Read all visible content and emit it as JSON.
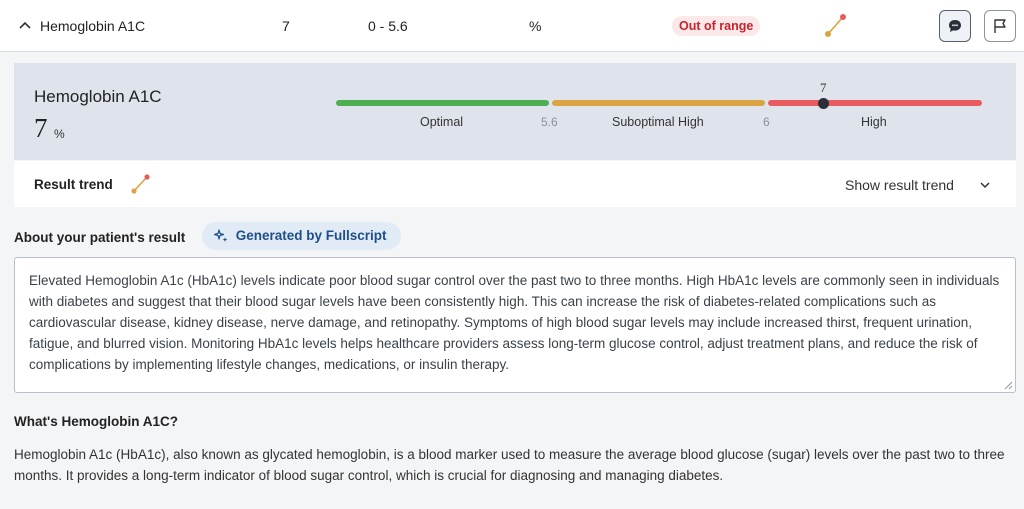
{
  "test_row": {
    "name": "Hemoglobin A1C",
    "value": "7",
    "range": "0 - 5.6",
    "unit": "%",
    "status": "Out of range"
  },
  "detail": {
    "title": "Hemoglobin A1C",
    "value": "7",
    "unit": "%",
    "scale": {
      "marker_value": 7,
      "marker_label": "7",
      "segments": [
        {
          "label": "Optimal",
          "from": 0,
          "to": 5.6,
          "color": "#4caf50"
        },
        {
          "label": "Suboptimal High",
          "from": 5.6,
          "to": 6,
          "color": "#d9a441"
        },
        {
          "label": "High",
          "from": 6,
          "to": null,
          "color": "#e85b5e"
        }
      ],
      "ticks": [
        "5.6",
        "6"
      ]
    }
  },
  "trend": {
    "label": "Result trend",
    "toggle_label": "Show result trend"
  },
  "about": {
    "label": "About your patient's result",
    "generated_label": "Generated by Fullscript",
    "summary": "Elevated Hemoglobin A1c (HbA1c) levels indicate poor blood sugar control over the past two to three months. High HbA1c levels are commonly seen in individuals with diabetes and suggest that their blood sugar levels have been consistently high. This can increase the risk of diabetes-related complications such as cardiovascular disease, kidney disease, nerve damage, and retinopathy. Symptoms of high blood sugar levels may include increased thirst, frequent urination, fatigue, and blurred vision. Monitoring HbA1c levels helps healthcare providers assess long-term glucose control, adjust treatment plans, and reduce the risk of complications by implementing lifestyle changes, medications, or insulin therapy."
  },
  "what": {
    "title": "What's Hemoglobin A1C?",
    "text": "Hemoglobin A1c (HbA1c), also known as glycated hemoglobin, is a blood marker used to measure the average blood glucose (sugar) levels over the past two to three months. It provides a long-term indicator of blood sugar control, which is crucial for diagnosing and managing diabetes."
  },
  "colors": {
    "out_of_range_text": "#c8232c",
    "out_of_range_bg": "#fbe9ea",
    "pill_text": "#1f4f86",
    "trend_line": "#d9a441",
    "trend_point": "#e85b5e"
  },
  "icons": {
    "collapse": "chevron-up-icon",
    "trend": "trend-line-icon",
    "comment": "comment-icon",
    "flag": "flag-icon",
    "sparkle": "sparkle-icon",
    "expand": "chevron-down-icon"
  }
}
